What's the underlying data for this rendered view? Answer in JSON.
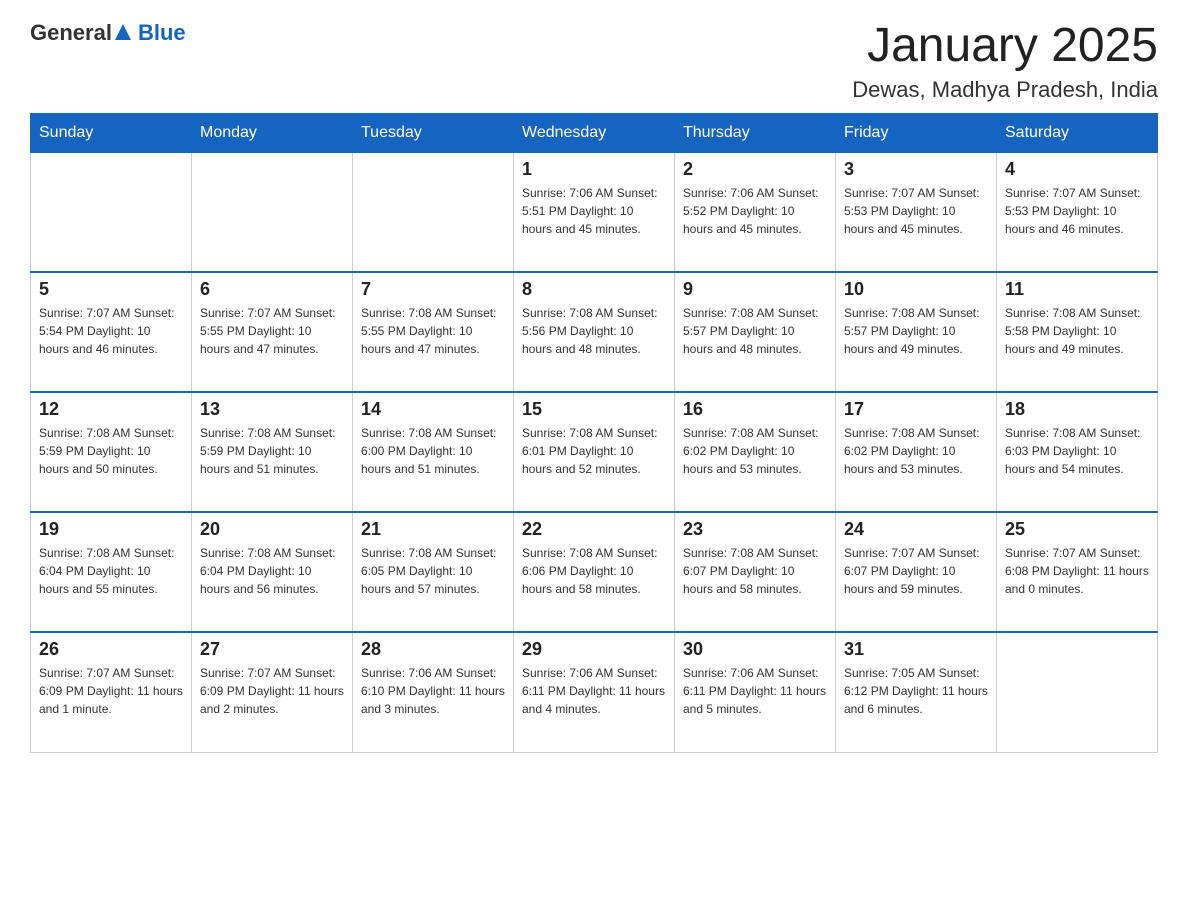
{
  "header": {
    "logo_general": "General",
    "logo_blue": "Blue",
    "title": "January 2025",
    "subtitle": "Dewas, Madhya Pradesh, India"
  },
  "weekdays": [
    "Sunday",
    "Monday",
    "Tuesday",
    "Wednesday",
    "Thursday",
    "Friday",
    "Saturday"
  ],
  "weeks": [
    [
      {
        "day": "",
        "info": ""
      },
      {
        "day": "",
        "info": ""
      },
      {
        "day": "",
        "info": ""
      },
      {
        "day": "1",
        "info": "Sunrise: 7:06 AM\nSunset: 5:51 PM\nDaylight: 10 hours\nand 45 minutes."
      },
      {
        "day": "2",
        "info": "Sunrise: 7:06 AM\nSunset: 5:52 PM\nDaylight: 10 hours\nand 45 minutes."
      },
      {
        "day": "3",
        "info": "Sunrise: 7:07 AM\nSunset: 5:53 PM\nDaylight: 10 hours\nand 45 minutes."
      },
      {
        "day": "4",
        "info": "Sunrise: 7:07 AM\nSunset: 5:53 PM\nDaylight: 10 hours\nand 46 minutes."
      }
    ],
    [
      {
        "day": "5",
        "info": "Sunrise: 7:07 AM\nSunset: 5:54 PM\nDaylight: 10 hours\nand 46 minutes."
      },
      {
        "day": "6",
        "info": "Sunrise: 7:07 AM\nSunset: 5:55 PM\nDaylight: 10 hours\nand 47 minutes."
      },
      {
        "day": "7",
        "info": "Sunrise: 7:08 AM\nSunset: 5:55 PM\nDaylight: 10 hours\nand 47 minutes."
      },
      {
        "day": "8",
        "info": "Sunrise: 7:08 AM\nSunset: 5:56 PM\nDaylight: 10 hours\nand 48 minutes."
      },
      {
        "day": "9",
        "info": "Sunrise: 7:08 AM\nSunset: 5:57 PM\nDaylight: 10 hours\nand 48 minutes."
      },
      {
        "day": "10",
        "info": "Sunrise: 7:08 AM\nSunset: 5:57 PM\nDaylight: 10 hours\nand 49 minutes."
      },
      {
        "day": "11",
        "info": "Sunrise: 7:08 AM\nSunset: 5:58 PM\nDaylight: 10 hours\nand 49 minutes."
      }
    ],
    [
      {
        "day": "12",
        "info": "Sunrise: 7:08 AM\nSunset: 5:59 PM\nDaylight: 10 hours\nand 50 minutes."
      },
      {
        "day": "13",
        "info": "Sunrise: 7:08 AM\nSunset: 5:59 PM\nDaylight: 10 hours\nand 51 minutes."
      },
      {
        "day": "14",
        "info": "Sunrise: 7:08 AM\nSunset: 6:00 PM\nDaylight: 10 hours\nand 51 minutes."
      },
      {
        "day": "15",
        "info": "Sunrise: 7:08 AM\nSunset: 6:01 PM\nDaylight: 10 hours\nand 52 minutes."
      },
      {
        "day": "16",
        "info": "Sunrise: 7:08 AM\nSunset: 6:02 PM\nDaylight: 10 hours\nand 53 minutes."
      },
      {
        "day": "17",
        "info": "Sunrise: 7:08 AM\nSunset: 6:02 PM\nDaylight: 10 hours\nand 53 minutes."
      },
      {
        "day": "18",
        "info": "Sunrise: 7:08 AM\nSunset: 6:03 PM\nDaylight: 10 hours\nand 54 minutes."
      }
    ],
    [
      {
        "day": "19",
        "info": "Sunrise: 7:08 AM\nSunset: 6:04 PM\nDaylight: 10 hours\nand 55 minutes."
      },
      {
        "day": "20",
        "info": "Sunrise: 7:08 AM\nSunset: 6:04 PM\nDaylight: 10 hours\nand 56 minutes."
      },
      {
        "day": "21",
        "info": "Sunrise: 7:08 AM\nSunset: 6:05 PM\nDaylight: 10 hours\nand 57 minutes."
      },
      {
        "day": "22",
        "info": "Sunrise: 7:08 AM\nSunset: 6:06 PM\nDaylight: 10 hours\nand 58 minutes."
      },
      {
        "day": "23",
        "info": "Sunrise: 7:08 AM\nSunset: 6:07 PM\nDaylight: 10 hours\nand 58 minutes."
      },
      {
        "day": "24",
        "info": "Sunrise: 7:07 AM\nSunset: 6:07 PM\nDaylight: 10 hours\nand 59 minutes."
      },
      {
        "day": "25",
        "info": "Sunrise: 7:07 AM\nSunset: 6:08 PM\nDaylight: 11 hours\nand 0 minutes."
      }
    ],
    [
      {
        "day": "26",
        "info": "Sunrise: 7:07 AM\nSunset: 6:09 PM\nDaylight: 11 hours\nand 1 minute."
      },
      {
        "day": "27",
        "info": "Sunrise: 7:07 AM\nSunset: 6:09 PM\nDaylight: 11 hours\nand 2 minutes."
      },
      {
        "day": "28",
        "info": "Sunrise: 7:06 AM\nSunset: 6:10 PM\nDaylight: 11 hours\nand 3 minutes."
      },
      {
        "day": "29",
        "info": "Sunrise: 7:06 AM\nSunset: 6:11 PM\nDaylight: 11 hours\nand 4 minutes."
      },
      {
        "day": "30",
        "info": "Sunrise: 7:06 AM\nSunset: 6:11 PM\nDaylight: 11 hours\nand 5 minutes."
      },
      {
        "day": "31",
        "info": "Sunrise: 7:05 AM\nSunset: 6:12 PM\nDaylight: 11 hours\nand 6 minutes."
      },
      {
        "day": "",
        "info": ""
      }
    ]
  ]
}
